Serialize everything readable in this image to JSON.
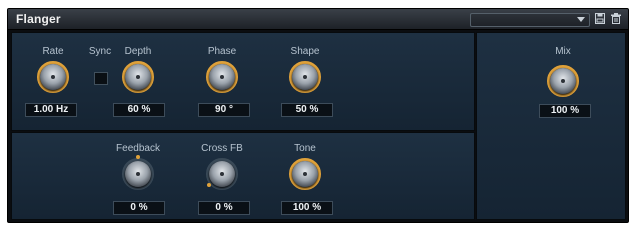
{
  "plugin": {
    "title": "Flanger",
    "preset": "",
    "icons": {
      "save": "save-icon",
      "delete": "trash-icon"
    }
  },
  "controls": {
    "rate": {
      "label": "Rate",
      "value": "1.00 Hz",
      "level": 0.55
    },
    "sync": {
      "label": "Sync",
      "checked": false
    },
    "depth": {
      "label": "Depth",
      "value": "60 %",
      "level": 0.6
    },
    "phase": {
      "label": "Phase",
      "value": "90 °",
      "level": 0.5
    },
    "shape": {
      "label": "Shape",
      "value": "50 %",
      "level": 0.5
    },
    "feedback": {
      "label": "Feedback",
      "value": "0 %",
      "level": 0.0
    },
    "crossfb": {
      "label": "Cross FB",
      "value": "0 %",
      "level": 0.0
    },
    "tone": {
      "label": "Tone",
      "value": "100 %",
      "level": 1.0
    },
    "mix": {
      "label": "Mix",
      "value": "100 %",
      "level": 1.0
    }
  },
  "colors": {
    "accent": "#e0a23a",
    "panel": "#1a2a3a",
    "frame": "#0b0d10"
  }
}
